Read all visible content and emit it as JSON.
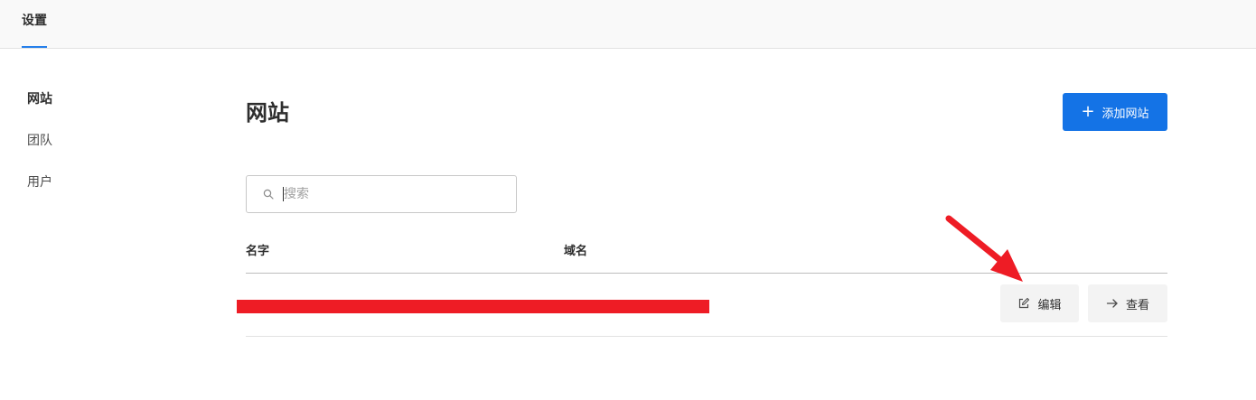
{
  "topbar": {
    "tab_label": "设置"
  },
  "sidebar": {
    "items": [
      {
        "label": "网站",
        "active": true
      },
      {
        "label": "团队",
        "active": false
      },
      {
        "label": "用户",
        "active": false
      }
    ]
  },
  "main": {
    "title": "网站",
    "add_button_label": "添加网站",
    "search": {
      "placeholder": "搜索",
      "value": ""
    },
    "table": {
      "columns": [
        "名字",
        "域名"
      ],
      "rows": [
        {
          "edit_label": "编辑",
          "view_label": "查看"
        }
      ]
    }
  },
  "colors": {
    "accent": "#1473e6",
    "tab_underline": "#2680eb",
    "annotation_red": "#ee1c25"
  },
  "icons": [
    "plus-icon",
    "search-icon",
    "edit-icon",
    "arrow-right-icon"
  ]
}
